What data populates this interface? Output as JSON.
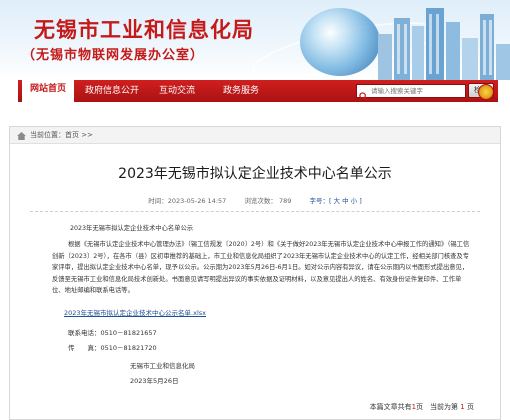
{
  "header": {
    "site_title": "无锡市工业和信息化局",
    "site_subtitle": "（无锡市物联网发展办公室）"
  },
  "nav": {
    "items": [
      {
        "label": "网站首页"
      },
      {
        "label": "政府信息公开"
      },
      {
        "label": "互动交流"
      },
      {
        "label": "政务服务"
      }
    ],
    "search_placeholder": "请输入搜索关键字",
    "search_button": "检索"
  },
  "breadcrumb": {
    "text": "当前位置：首页 >>"
  },
  "article": {
    "title": "2023年无锡市拟认定企业技术中心名单公示",
    "meta": {
      "time": "时间：2023-05-26 14:57",
      "views": "浏览次数：  789",
      "font_size": "字号：[ 大 中 小 ]"
    },
    "paragraph_1": "2023年无锡市拟认定企业技术中心名单公示",
    "paragraph_2": "根据《无锡市认定企业技术中心管理办法》（锡工信规发〔2020〕2号）和《关于做好2023年无锡市认定企业技术中心申报工作的通知》（锡工信创新〔2023〕2号），在各市（县）区初审推荐的基础上，市工业和信息化局组织了2023年无锡市认定企业技术中心的认定工作，经相关部门核查及专家评审，提出拟认定企业技术中心名单，现予以公示。公示期为2023年5月26日-6月1日。如对公示内容有异议，请在公示期内以书面形式提出意见，反馈至无锡市工业和信息化局技术创新处。书面意见请写明提出异议的事实依据及证明材料，以及意见提出人的姓名、有效身份证件复印件、工作单位、地址邮编和联系电话等。",
    "attachment": "2023年无锡市拟认定企业技术中心公示名单.xlsx",
    "contact_phone": "联系电话：0510－81821657",
    "contact_fax": "传　　真：0510－81821720",
    "signature_org": "无锡市工业和信息化局",
    "signature_date": "2023年5月26日"
  },
  "pager": {
    "prefix": "本篇文章共有",
    "total_pages": "1",
    "middle": "页　当前为第",
    "current_page": "1",
    "suffix": "页"
  },
  "colors": {
    "brand_red": "#c41a1a",
    "link_blue": "#1f4f94"
  }
}
